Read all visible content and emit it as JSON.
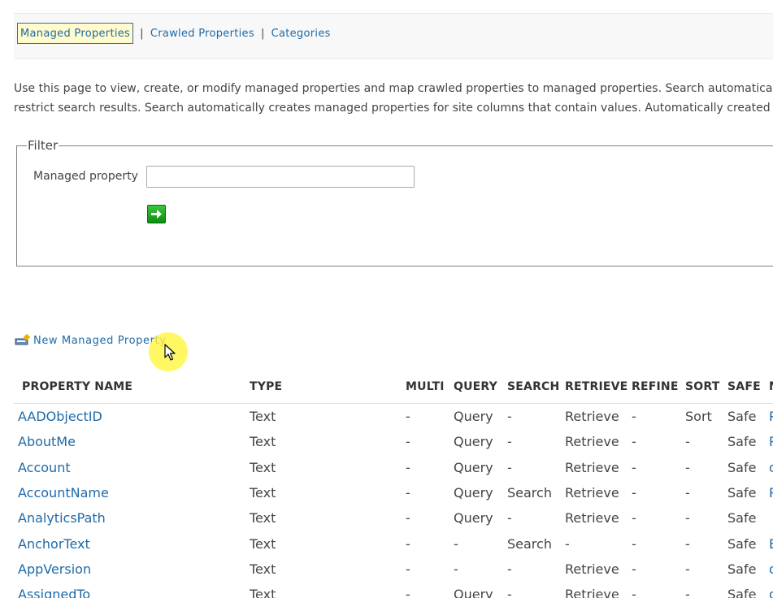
{
  "nav": {
    "tabs": [
      {
        "label": "Managed Properties",
        "active": true
      },
      {
        "label": "Crawled Properties",
        "active": false
      },
      {
        "label": "Categories",
        "active": false
      }
    ],
    "separator": "|"
  },
  "description": {
    "line1": "Use this page to view, create, or modify managed properties and map crawled properties to managed properties. Search automatically",
    "line2": "restrict search results. Search automatically creates managed properties for site columns that contain values. Automatically created m"
  },
  "filter": {
    "legend": "Filter",
    "field_label": "Managed property",
    "field_value": "",
    "go_icon": "arrow-right-icon"
  },
  "new_property": {
    "label": "New Managed Property",
    "icon": "new-property-icon"
  },
  "table": {
    "columns": [
      "PROPERTY NAME",
      "TYPE",
      "MULTI",
      "QUERY",
      "SEARCH",
      "RETRIEVE",
      "REFINE",
      "SORT",
      "SAFE",
      "M"
    ],
    "rows": [
      [
        "AADObjectID",
        "Text",
        "-",
        "Query",
        "-",
        "Retrieve",
        "-",
        "Sort",
        "Safe",
        "P"
      ],
      [
        "AboutMe",
        "Text",
        "-",
        "Query",
        "-",
        "Retrieve",
        "-",
        "-",
        "Safe",
        "P"
      ],
      [
        "Account",
        "Text",
        "-",
        "Query",
        "-",
        "Retrieve",
        "-",
        "-",
        "Safe",
        "o"
      ],
      [
        "AccountName",
        "Text",
        "-",
        "Query",
        "Search",
        "Retrieve",
        "-",
        "-",
        "Safe",
        "P"
      ],
      [
        "AnalyticsPath",
        "Text",
        "-",
        "Query",
        "-",
        "Retrieve",
        "-",
        "-",
        "Safe",
        ""
      ],
      [
        "AnchorText",
        "Text",
        "-",
        "-",
        "Search",
        "-",
        "-",
        "-",
        "Safe",
        "E"
      ],
      [
        "AppVersion",
        "Text",
        "-",
        "-",
        "-",
        "Retrieve",
        "-",
        "-",
        "Safe",
        "o"
      ],
      [
        "AssignedTo",
        "Text",
        "-",
        "Query",
        "-",
        "Retrieve",
        "-",
        "-",
        "Safe",
        "o"
      ]
    ]
  },
  "colors": {
    "link": "#1e6aa8",
    "active_tab_bg": "#fffbcc",
    "text": "#444444",
    "highlight": "#fff53c"
  }
}
